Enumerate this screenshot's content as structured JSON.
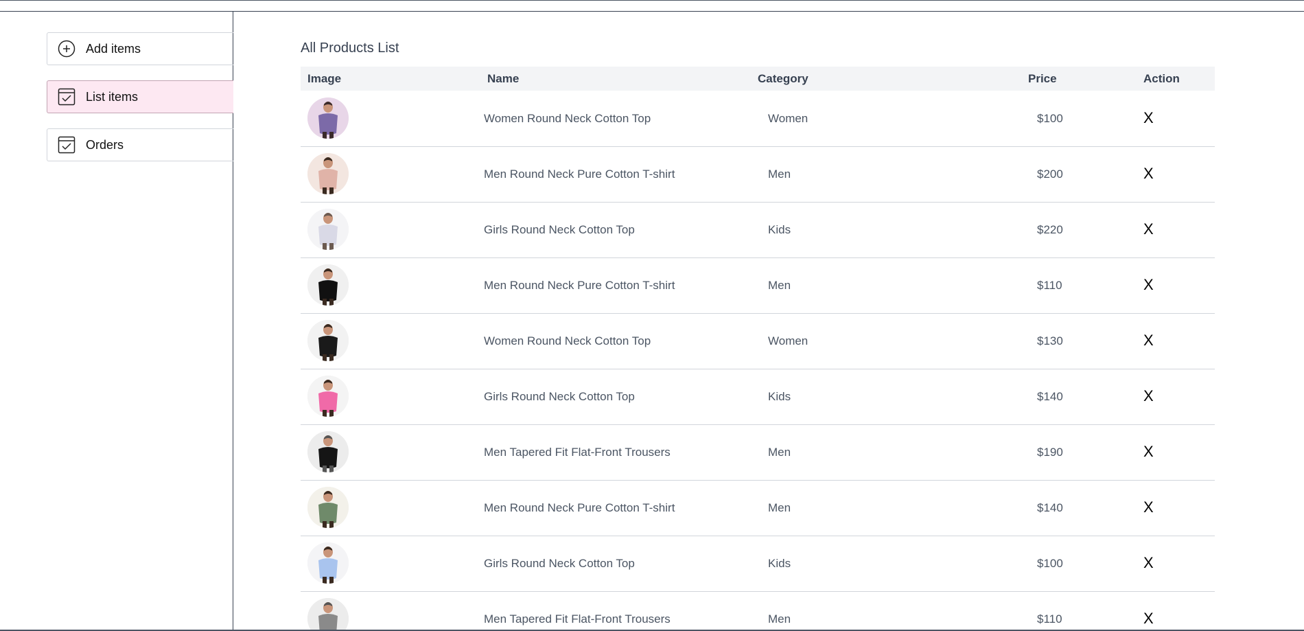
{
  "sidebar": {
    "items": [
      {
        "label": "Add items",
        "icon": "add-circle-icon"
      },
      {
        "label": "List items",
        "icon": "checklist-icon",
        "active": true
      },
      {
        "label": "Orders",
        "icon": "checklist-icon"
      }
    ]
  },
  "main": {
    "title": "All Products List",
    "columns": [
      "Image",
      "Name",
      "Category",
      "Price",
      "Action"
    ],
    "rows": [
      {
        "name": "Women Round Neck Cotton Top",
        "category": "Women",
        "price": "$100",
        "action": "X",
        "colors": [
          "#7c6aa8",
          "#e8d6e8",
          "#3a2a2a"
        ]
      },
      {
        "name": "Men Round Neck Pure Cotton T-shirt",
        "category": "Men",
        "price": "$200",
        "action": "X",
        "colors": [
          "#e0b3a8",
          "#f3e6e0",
          "#3a2a20"
        ]
      },
      {
        "name": "Girls Round Neck Cotton Top",
        "category": "Kids",
        "price": "$220",
        "action": "X",
        "colors": [
          "#d9d9e6",
          "#f4f4f6",
          "#6b5a50"
        ]
      },
      {
        "name": "Men Round Neck Pure Cotton T-shirt",
        "category": "Men",
        "price": "$110",
        "action": "X",
        "colors": [
          "#111111",
          "#f0f0f0",
          "#3a2a20"
        ]
      },
      {
        "name": "Women Round Neck Cotton Top",
        "category": "Women",
        "price": "$130",
        "action": "X",
        "colors": [
          "#1a1a1a",
          "#f2f2f2",
          "#3a2a20"
        ]
      },
      {
        "name": "Girls Round Neck Cotton Top",
        "category": "Kids",
        "price": "$140",
        "action": "X",
        "colors": [
          "#f06aa8",
          "#f4f4f4",
          "#3a2a20"
        ]
      },
      {
        "name": "Men Tapered Fit Flat-Front Trousers",
        "category": "Men",
        "price": "$190",
        "action": "X",
        "colors": [
          "#151515",
          "#ececec",
          "#555555"
        ]
      },
      {
        "name": "Men Round Neck Pure Cotton T-shirt",
        "category": "Men",
        "price": "$140",
        "action": "X",
        "colors": [
          "#6f8a6a",
          "#f3f1ea",
          "#3a2a20"
        ]
      },
      {
        "name": "Girls Round Neck Cotton Top",
        "category": "Kids",
        "price": "$100",
        "action": "X",
        "colors": [
          "#a9c4ee",
          "#f4f4f6",
          "#3a2a20"
        ]
      },
      {
        "name": "Men Tapered Fit Flat-Front Trousers",
        "category": "Men",
        "price": "$110",
        "action": "X",
        "colors": [
          "#8a8a8a",
          "#ececec",
          "#555555"
        ]
      }
    ]
  }
}
